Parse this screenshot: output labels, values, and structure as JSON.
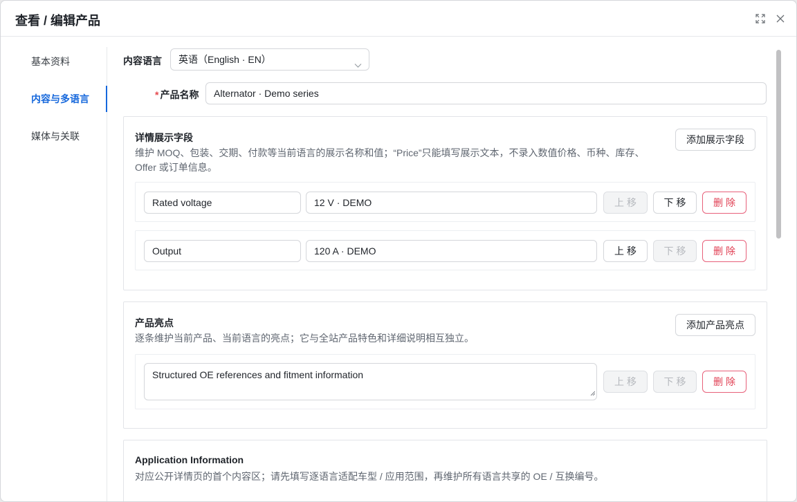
{
  "dialog": {
    "title": "查看 / 编辑产品",
    "icons": {
      "maximize": "expand-icon",
      "close": "close-icon"
    }
  },
  "nav": {
    "items": [
      {
        "label": "基本资料",
        "active": false
      },
      {
        "label": "内容与多语言",
        "active": true
      },
      {
        "label": "媒体与关联",
        "active": false
      }
    ]
  },
  "form": {
    "language_label": "内容语言",
    "language_value": "英语（English · EN）",
    "name_required_mark": "*",
    "name_label": "产品名称",
    "name_value": "Alternator · Demo series"
  },
  "details": {
    "title": "详情展示字段",
    "desc_line1": "维护 MOQ、包装、交期、付款等当前语言的展示名称和值；“Price”只能填写展示文本，不录入数值价格、币种、库存、",
    "desc_line2": "Offer 或订单信息。",
    "add_button": "添加展示字段",
    "rows": [
      {
        "name": "Rated voltage",
        "value": "12 V · DEMO",
        "up": "上移",
        "down": "下移",
        "delete": "删除"
      },
      {
        "name": "Output",
        "value": "120 A · DEMO",
        "up": "上移",
        "down": "下移",
        "delete": "删除"
      }
    ]
  },
  "highlights": {
    "title": "产品亮点",
    "desc": "逐条维护当前产品、当前语言的亮点；它与全站产品特色和详细说明相互独立。",
    "add_button": "添加产品亮点",
    "rows": [
      {
        "text": "Structured OE references and fitment information",
        "up": "上移",
        "down": "下移",
        "delete": "删除"
      }
    ]
  },
  "application": {
    "title": "Application Information",
    "desc": "对应公开详情页的首个内容区；请先填写逐语言适配车型 / 应用范围，再维护所有语言共享的 OE / 互换编号。"
  },
  "colors": {
    "accent": "#1668dc",
    "danger": "#e03e52",
    "required": "#e5484d"
  }
}
